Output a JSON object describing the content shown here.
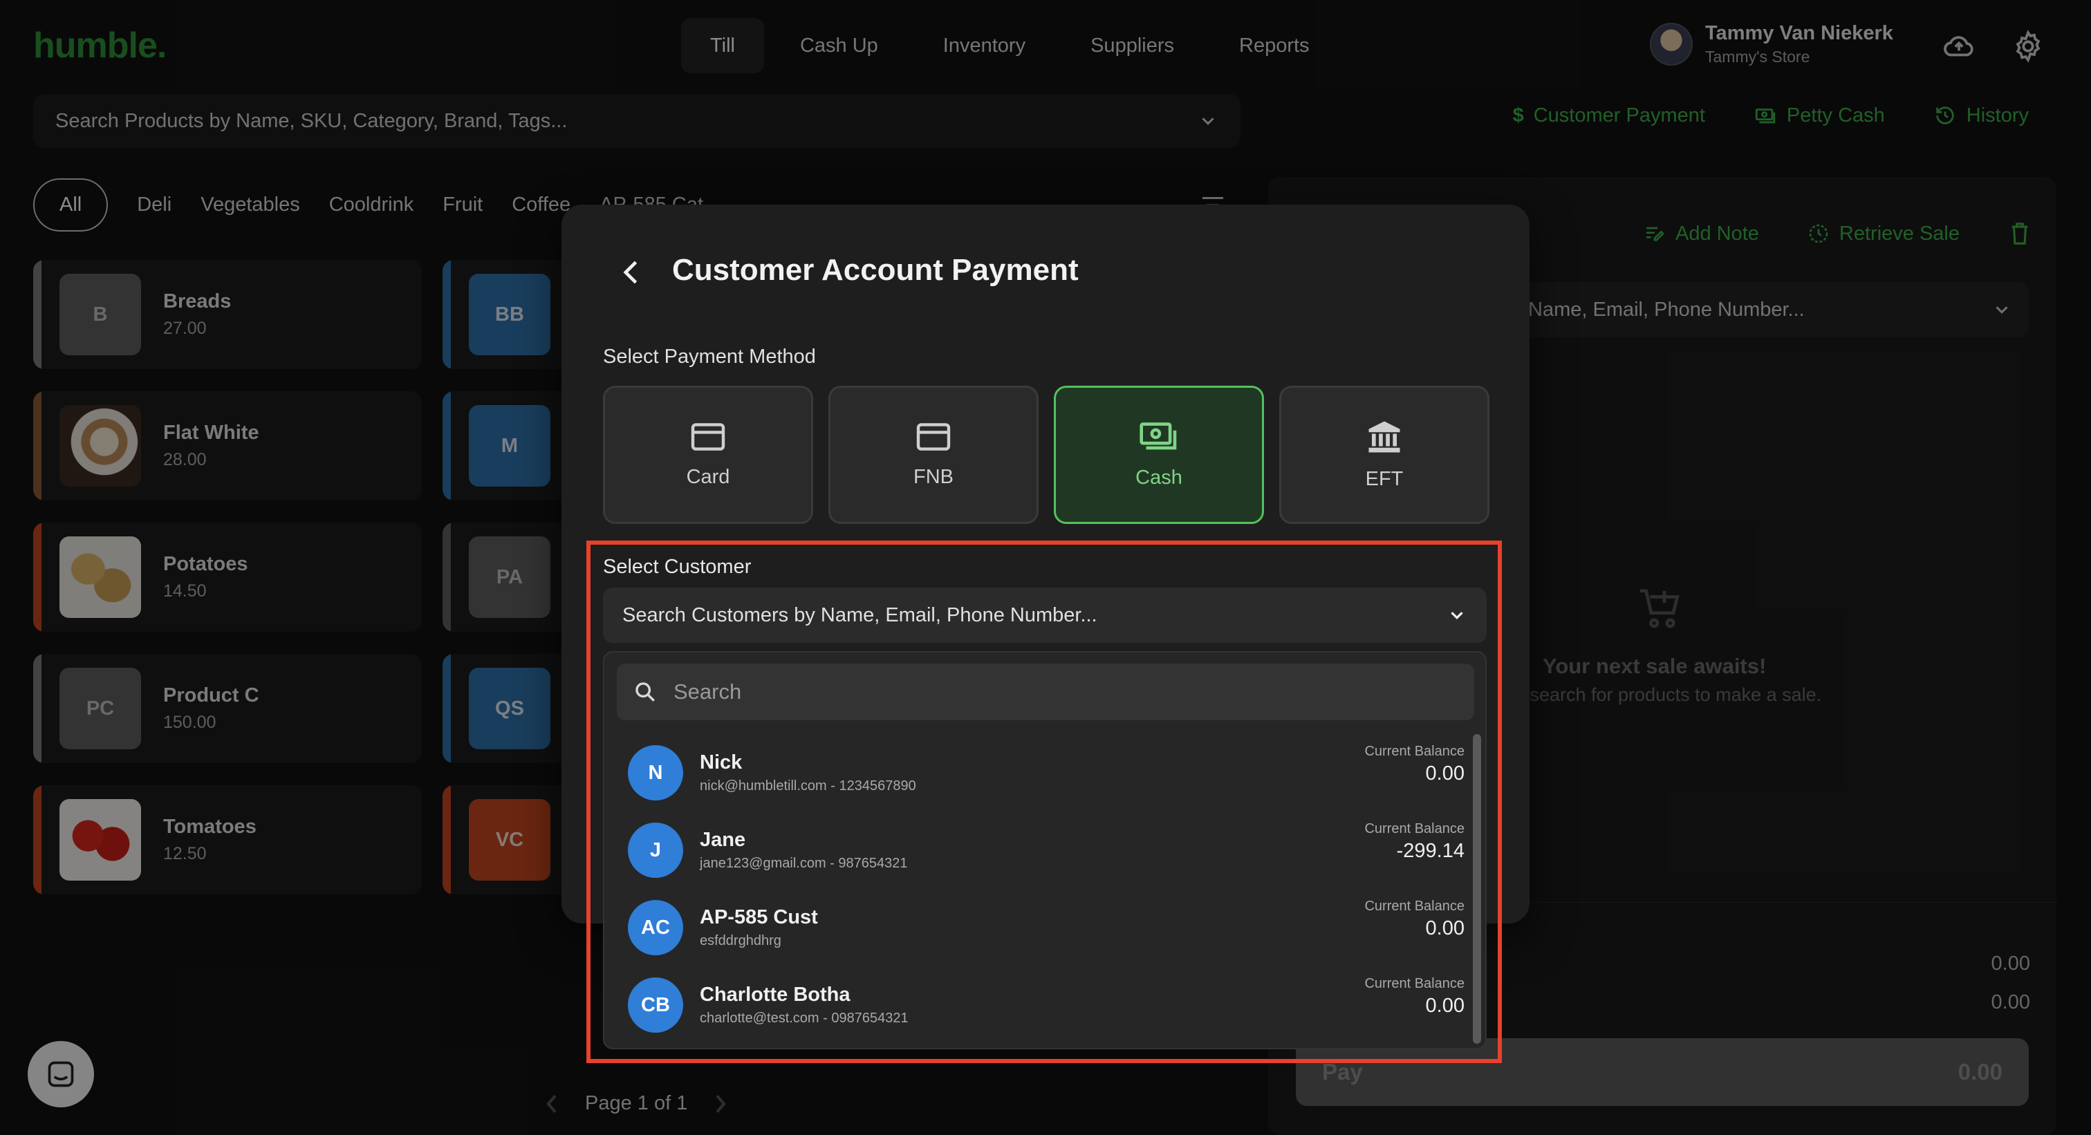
{
  "app": {
    "logo": "humble."
  },
  "nav": {
    "tabs": [
      {
        "label": "Till",
        "active": true
      },
      {
        "label": "Cash Up",
        "active": false
      },
      {
        "label": "Inventory",
        "active": false
      },
      {
        "label": "Suppliers",
        "active": false
      },
      {
        "label": "Reports",
        "active": false
      }
    ]
  },
  "user": {
    "name": "Tammy Van Niekerk",
    "store": "Tammy's Store"
  },
  "product_search": {
    "placeholder": "Search Products by Name, SKU, Category, Brand, Tags..."
  },
  "actions": {
    "customer_payment": "Customer Payment",
    "petty_cash": "Petty Cash",
    "history": "History"
  },
  "categories": [
    {
      "label": "All",
      "active": true
    },
    {
      "label": "Deli"
    },
    {
      "label": "Vegetables"
    },
    {
      "label": "Cooldrink"
    },
    {
      "label": "Fruit"
    },
    {
      "label": "Coffee"
    },
    {
      "label": "AP-585 Cat"
    }
  ],
  "products": [
    {
      "name": "Breads",
      "price": "27.00",
      "initials": "B",
      "accent": "#7a7a7a"
    },
    {
      "name": "Flat White",
      "price": "28.00",
      "initials": "",
      "accent": "#8a5a3a"
    },
    {
      "name": "Potatoes",
      "price": "14.50",
      "initials": "",
      "accent": "#c2461f"
    },
    {
      "name": "Product C",
      "price": "150.00",
      "initials": "PC",
      "accent": "#7a7a7a"
    },
    {
      "name": "Tomatoes",
      "price": "12.50",
      "initials": "",
      "accent": "#c2461f"
    }
  ],
  "products_col2": [
    {
      "initials": "BB",
      "color": "#2f6fa8"
    },
    {
      "initials": "M",
      "color": "#2f6fa8"
    },
    {
      "initials": "PA",
      "color": "#5e5e5e"
    },
    {
      "initials": "QS",
      "color": "#2f6fa8"
    },
    {
      "initials": "VC",
      "color": "#c2461f"
    }
  ],
  "cart": {
    "add_note": "Add Note",
    "retrieve_sale": "Retrieve Sale",
    "customer_placeholder": "Name, Email, Phone Number...",
    "empty_title": "Your next sale awaits!",
    "empty_subtitle": "r search for products to make a sale.",
    "total_1": "0.00",
    "total_2": "0.00",
    "pay_label": "Pay",
    "pay_amount": "0.00"
  },
  "pager": {
    "label": "Page 1 of 1"
  },
  "modal": {
    "title": "Customer Account Payment",
    "payment_method_label": "Select Payment Method",
    "payment_methods": [
      {
        "label": "Card",
        "icon": "card-icon",
        "selected": false
      },
      {
        "label": "FNB",
        "icon": "card-icon",
        "selected": false
      },
      {
        "label": "Cash",
        "icon": "cash-icon",
        "selected": true
      },
      {
        "label": "EFT",
        "icon": "bank-icon",
        "selected": false
      }
    ],
    "select_customer_label": "Select Customer",
    "customer_select_placeholder": "Search Customers by Name, Email, Phone Number...",
    "dropdown_search_placeholder": "Search",
    "customers": [
      {
        "initials": "N",
        "name": "Nick",
        "sub": "nick@humbletill.com - 1234567890",
        "balance_label": "Current Balance",
        "balance": "0.00"
      },
      {
        "initials": "J",
        "name": "Jane",
        "sub": "jane123@gmail.com - 987654321",
        "balance_label": "Current Balance",
        "balance": "-299.14"
      },
      {
        "initials": "AC",
        "name": "AP-585 Cust",
        "sub": "esfddrghdhrg",
        "balance_label": "Current Balance",
        "balance": "0.00"
      },
      {
        "initials": "CB",
        "name": "Charlotte Botha",
        "sub": "charlotte@test.com - 0987654321",
        "balance_label": "Current Balance",
        "balance": "0.00"
      }
    ]
  },
  "colors": {
    "accent_green": "#3fae4a",
    "highlight_red": "#e8412c",
    "avatar_blue": "#2f7ed8"
  }
}
